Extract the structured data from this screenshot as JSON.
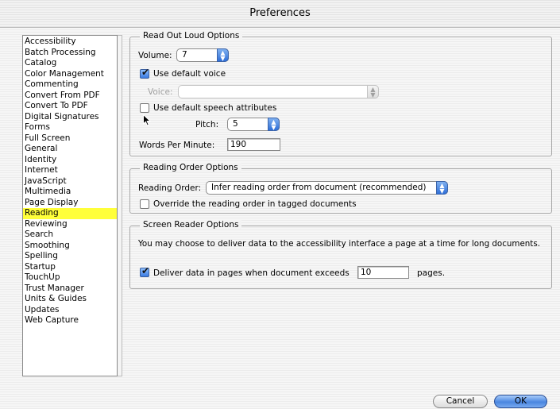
{
  "window": {
    "title": "Preferences"
  },
  "sidebar": {
    "selected": "Reading",
    "items": [
      "Accessibility",
      "Batch Processing",
      "Catalog",
      "Color Management",
      "Commenting",
      "Convert From PDF",
      "Convert To PDF",
      "Digital Signatures",
      "Forms",
      "Full Screen",
      "General",
      "Identity",
      "Internet",
      "JavaScript",
      "Multimedia",
      "Page Display",
      "Reading",
      "Reviewing",
      "Search",
      "Smoothing",
      "Spelling",
      "Startup",
      "TouchUp",
      "Trust Manager",
      "Units & Guides",
      "Updates",
      "Web Capture"
    ]
  },
  "read_out_loud": {
    "legend": "Read Out Loud Options",
    "volume_label": "Volume:",
    "volume_value": "7",
    "default_voice_label": "Use default voice",
    "default_voice_checked": true,
    "voice_label": "Voice:",
    "voice_value": "",
    "default_speech_label": "Use default speech attributes",
    "default_speech_checked": false,
    "pitch_label": "Pitch:",
    "pitch_value": "5",
    "wpm_label": "Words Per Minute:",
    "wpm_value": "190"
  },
  "reading_order": {
    "legend": "Reading Order Options",
    "order_label": "Reading Order:",
    "order_value": "Infer reading order from document (recommended)",
    "override_label": "Override the reading order in tagged documents",
    "override_checked": false
  },
  "screen_reader": {
    "legend": "Screen Reader Options",
    "description": "You may choose to deliver data to the accessibility interface a page at a time for long documents.",
    "deliver_label": "Deliver data in pages when document exceeds",
    "deliver_checked": true,
    "pages_value": "10",
    "pages_suffix": "pages."
  },
  "buttons": {
    "cancel": "Cancel",
    "ok": "OK"
  },
  "colors": {
    "selection": "#ffff3a",
    "accent": "#3b7be0"
  }
}
